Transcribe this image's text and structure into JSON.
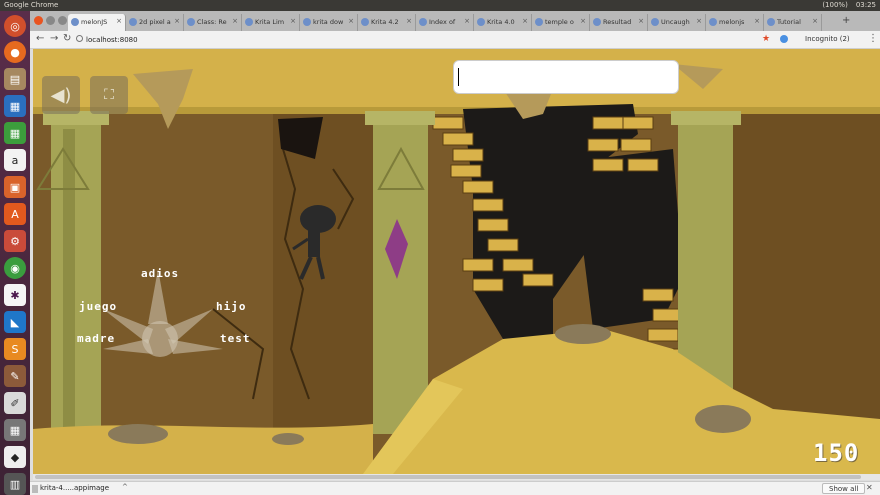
{
  "panel": {
    "title": "Google Chrome",
    "battery": "(100%)",
    "time": "03:25"
  },
  "browser": {
    "tabs": [
      {
        "label": "melonJS",
        "active": true
      },
      {
        "label": "2d pixel a"
      },
      {
        "label": "Class: Re"
      },
      {
        "label": "Krita Lim"
      },
      {
        "label": "krita dow"
      },
      {
        "label": "Krita 4.2"
      },
      {
        "label": "Index of"
      },
      {
        "label": "Krita 4.0"
      },
      {
        "label": "temple o"
      },
      {
        "label": "Resultad"
      },
      {
        "label": "Uncaugh"
      },
      {
        "label": "melonjs"
      },
      {
        "label": "Tutorial"
      }
    ],
    "url": "localhost:8080",
    "incognito": "Incognito (2)"
  },
  "game": {
    "radial_menu": [
      "adios",
      "juego",
      "hijo",
      "madre",
      "test"
    ],
    "score": "150",
    "chat_input_value": ""
  },
  "download": {
    "file": "krita-4.....appimage",
    "show_all": "Show all"
  },
  "icons": [
    "sound-icon",
    "fullscreen-icon"
  ],
  "colors": {
    "accent": "#e95420",
    "sky": "#d4b14a",
    "wall": "#7a5a2a",
    "pillar": "#a5a455",
    "crystal": "#8e3d86"
  }
}
